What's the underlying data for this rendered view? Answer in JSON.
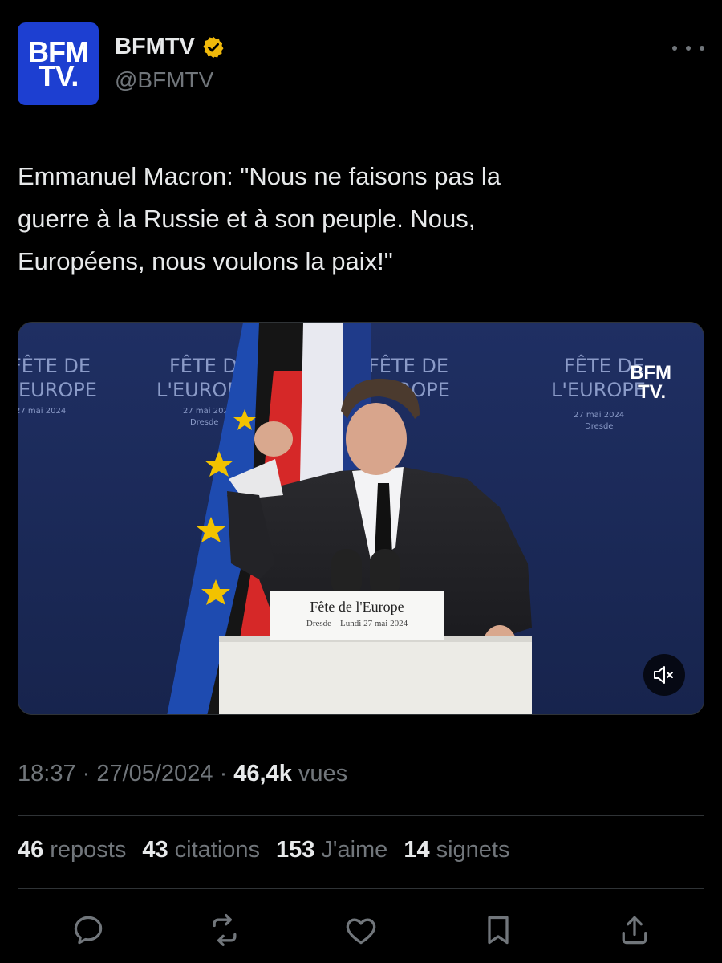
{
  "account": {
    "name": "BFMTV",
    "handle": "@BFMTV",
    "avatar": {
      "line1": "BFM",
      "line2": "TV.",
      "color": "#1d3fd1"
    },
    "verified_badge_color": "#f0b90b"
  },
  "tweet": {
    "text": "Emmanuel Macron: \"Nous ne faisons pas la\nguerre à la Russie et à son peuple. Nous,\nEuropéens, nous voulons la paix!\""
  },
  "media": {
    "type": "video",
    "backdrop_text": {
      "title_line1": "FÊTE DE",
      "title_line2": "L'EUROPE",
      "date": "27 mai 2024",
      "city": "Dresde"
    },
    "watermark": {
      "line1": "BFM",
      "line2": "TV."
    },
    "podium_sign": {
      "title": "Fête de l'Europe",
      "subtitle": "Dresde – Lundi 27 mai 2024"
    },
    "mute_icon": "speaker-muted-icon"
  },
  "meta": {
    "time": "18:37",
    "sep1": " · ",
    "date": "27/05/2024",
    "sep2": " · ",
    "views_count": "46,4k",
    "views_label": " vues"
  },
  "stats": {
    "reposts": {
      "count": "46",
      "label": "reposts"
    },
    "quotes": {
      "count": "43",
      "label": "citations"
    },
    "likes": {
      "count": "153",
      "label": "J'aime"
    },
    "bookmarks": {
      "count": "14",
      "label": "signets"
    }
  },
  "actions": [
    "reply-icon",
    "repost-icon",
    "like-icon",
    "bookmark-icon",
    "share-icon"
  ],
  "colors": {
    "background": "#000000",
    "text": "#e7e9ea",
    "secondary": "#71767b",
    "divider": "#2f3336"
  }
}
